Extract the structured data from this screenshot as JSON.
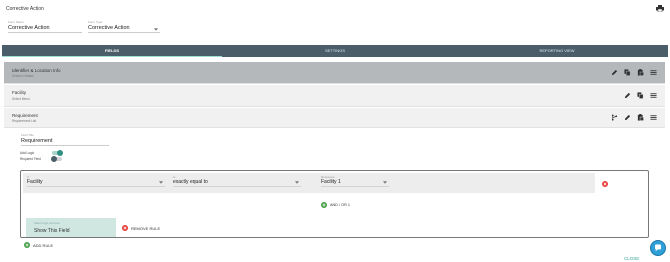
{
  "header": {
    "title": "Corrective Action",
    "print_icon": "printer-icon",
    "form_name": {
      "label": "Form Name",
      "value": "Corrective Action"
    },
    "form_type": {
      "label": "Form Type",
      "value": "Corrective Action"
    }
  },
  "tabs": [
    {
      "label": "FIELDS",
      "active": true
    },
    {
      "label": "SETTINGS",
      "active": false
    },
    {
      "label": "REPORTING VIEW",
      "active": false
    }
  ],
  "sections": [
    {
      "title": "Identifier & Location Info",
      "subtitle": "Section Header",
      "icons": [
        "pencil-icon",
        "copy-icon",
        "paste-icon",
        "drag-handle-icon"
      ]
    },
    {
      "title": "Facility",
      "subtitle": "Select Menu",
      "icons": [
        "pencil-icon",
        "copy-icon",
        "drag-handle-icon"
      ]
    },
    {
      "title": "Requirement",
      "subtitle": "Requirement List",
      "icons": [
        "branch-icon",
        "pencil-icon",
        "paste-icon",
        "drag-handle-icon"
      ]
    }
  ],
  "panel": {
    "field_label": {
      "label": "Field Title",
      "value": "Requirement"
    },
    "add_logic_label": "Add Logic",
    "add_logic_on": true,
    "required_label": "Required Field",
    "required_on": false,
    "rule": {
      "condition": {
        "field": {
          "label": "If",
          "value": "Facility"
        },
        "operator": {
          "label": "Is",
          "value": "exactly equal to"
        },
        "value": {
          "label": "Response",
          "value": "Facility 1"
        }
      },
      "and_or_label": "AND / OR 1",
      "action": {
        "label": "Select logic outcome",
        "value": "Show This Field"
      },
      "remove_rule_label": "REMOVE RULE"
    },
    "add_rule_label": "ADD RULE"
  },
  "footer": {
    "close_label": "CLOSE",
    "chat_icon": "chat-icon"
  },
  "colors": {
    "tab_bar": "#4a5d69",
    "accent": "#2f8f82",
    "danger": "#e53935",
    "success": "#43a047",
    "action_bg": "#cfe6e1"
  }
}
